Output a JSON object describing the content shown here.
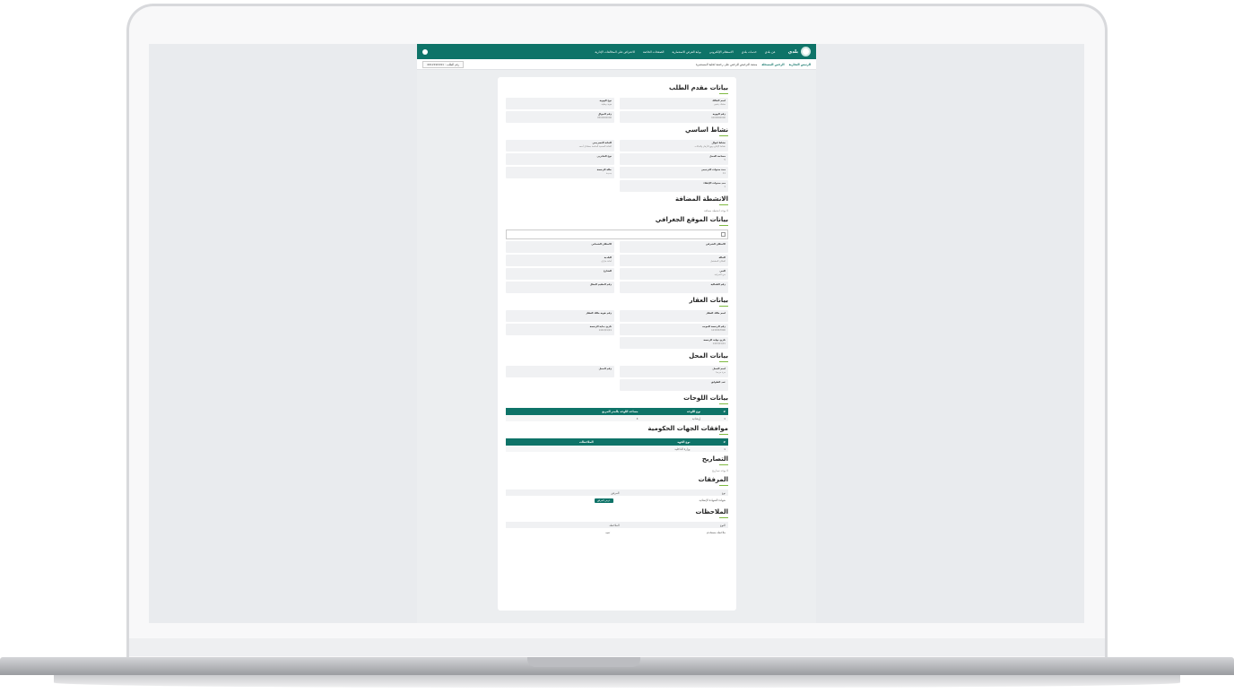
{
  "app": {
    "brand": "بلدي",
    "nav": [
      "عن بلدي",
      "خدمات بلدي",
      "الاستعلام الإلكتروني",
      "بوابة الفرص الاستثمارية",
      "الصفحات الخاصة",
      "الاعتراض على المخالفات الإدارية"
    ],
    "breadcrumbs": [
      "الرئيس التجارية",
      "الرخص المسجلة",
      "منصة الترخيص للرخص على رخصة لحلية المستثمرة"
    ],
    "request_number": "رقم الطلب : 4012190191"
  },
  "sections": {
    "applicant": {
      "title": "بيانات مقدم الطلب",
      "fields": [
        {
          "label": "اسم المالك",
          "value": "مشتك يتنجى"
        },
        {
          "label": "نوع الهوية",
          "value": "هوية وطنية"
        },
        {
          "label": "رقم الهوية",
          "value": "1000000000"
        },
        {
          "label": "رقم الجوال",
          "value": "0500000000"
        }
      ]
    },
    "main_activity": {
      "title": "نشاط اساسي",
      "fields": [
        {
          "label": "نشاط ليوال",
          "value": "نشاط الإنتاج وبيع الأزهار والنباتات"
        },
        {
          "label": "الخانة التصريحي",
          "value": "الخانة الصحية الخاصة بمشاتل أحمد"
        },
        {
          "label": "مساحة المحل",
          "value": "5"
        },
        {
          "label": "نوع الخانزين",
          "value": ""
        },
        {
          "label": "مدة سنوات الترخيص",
          "value": "11"
        },
        {
          "label": "حالة الرخصة",
          "value": "جديدة"
        },
        {
          "label": "مدد سنوات الإعفاء",
          "value": "1"
        }
      ]
    },
    "added": {
      "title": "الانشطة المضافة",
      "note": "لا يوجد انشطة مضافة"
    },
    "location": {
      "title": "بيانات الموقع الجغرافي",
      "fields": [
        {
          "label": "الاسكان الشرقي",
          "value": ""
        },
        {
          "label": "الاسكان الشماني",
          "value": ""
        },
        {
          "label": "الحالة",
          "value": "المكان المشتمل"
        },
        {
          "label": "البلدية",
          "value": "أمانة جازان"
        },
        {
          "label": "الحي",
          "value": "حي الحرابية"
        },
        {
          "label": "الشارع",
          "value": ""
        },
        {
          "label": "رقم الفعالية",
          "value": ""
        },
        {
          "label": "رقم المقيم البطل",
          "value": ""
        }
      ]
    },
    "property": {
      "title": "بيانات العقار",
      "fields": [
        {
          "label": "اسم مالك العقار",
          "value": ""
        },
        {
          "label": "رقم هوية مالك العقار",
          "value": ""
        },
        {
          "label": "رقم الرخصة الموحد",
          "value": "1234567890"
        },
        {
          "label": "تاريخ بداية الرخصة",
          "value": "1442/01/01"
        },
        {
          "label": "تاريخ نهاية الرخصة",
          "value": "1443/01/01"
        }
      ]
    },
    "shop": {
      "title": "بيانات المحل",
      "fields": [
        {
          "label": "اسم المحل",
          "value": "مرة مرحبا"
        },
        {
          "label": "رقم المحل",
          "value": ""
        },
        {
          "label": "عدد الطوابق",
          "value": ""
        }
      ]
    },
    "signs": {
      "title": "بيانات اللوحات",
      "headers": [
        "#",
        "نوع اللوحة",
        "مساحة اللوحة بالمتر المربع"
      ],
      "rows": [
        [
          "1",
          "إرشادية",
          "4"
        ]
      ]
    },
    "approvals": {
      "title": "موافقات الجهات الحكومية",
      "headers": [
        "#",
        "نوع الجهة",
        "الملاحظات"
      ],
      "rows": [
        [
          "1",
          "وزارة الداخلية",
          ""
        ]
      ]
    },
    "permits": {
      "title": "التصاريح",
      "note": "لا يوجد تصاريح"
    },
    "attachments": {
      "title": "المرفقات",
      "header": [
        "نوع",
        "المرفق"
      ],
      "row": [
        "شهادة الشهادة الإنشائية",
        "عرض المرفق"
      ]
    },
    "notes": {
      "title": "الملاحظات",
      "header": [
        "النوع",
        "الملاحظة"
      ],
      "row": [
        "ملاحظة مستخدم",
        "تنبيه"
      ]
    }
  }
}
